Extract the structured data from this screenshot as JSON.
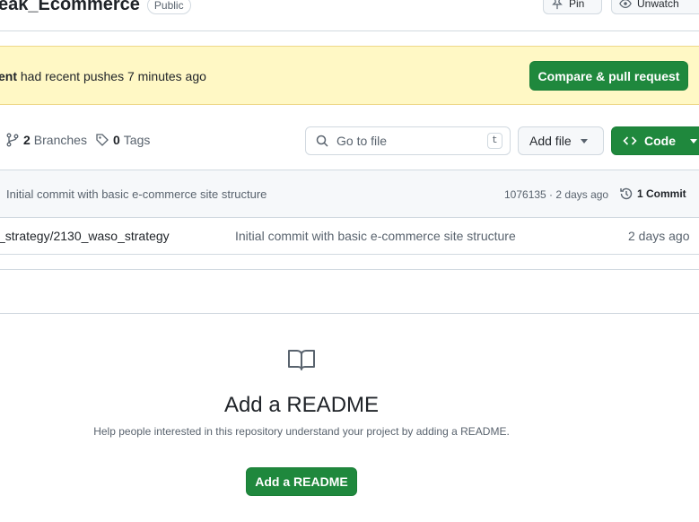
{
  "header": {
    "repo_name": "eak_Ecommerce",
    "visibility": "Public",
    "pin_label": "Pin",
    "watch_label": "Unwatch"
  },
  "banner": {
    "branch": "ent",
    "message": " had recent pushes 7 minutes ago",
    "compare_label": "Compare & pull request"
  },
  "toolbar": {
    "branches_count": "2",
    "branches_label": "Branches",
    "tags_count": "0",
    "tags_label": "Tags",
    "search_placeholder": "Go to file",
    "search_shortcut": "t",
    "add_file_label": "Add file",
    "code_label": "Code"
  },
  "latest_commit": {
    "message": "Initial commit with basic e-commerce site structure",
    "meta": "1076135 · 2 days ago",
    "commits_label": "1 Commit"
  },
  "files": [
    {
      "name": "_strategy/2130_waso_strategy",
      "commit": "Initial commit with basic e-commerce site structure",
      "age": "2 days ago"
    }
  ],
  "readme": {
    "title": "Add a README",
    "description": "Help people interested in this repository understand your project by adding a README.",
    "button_label": "Add a README"
  },
  "colors": {
    "primary_green": "#1f883d",
    "banner_bg": "#fff8c5",
    "border": "#d1d9e0",
    "muted_text": "#59636e"
  }
}
